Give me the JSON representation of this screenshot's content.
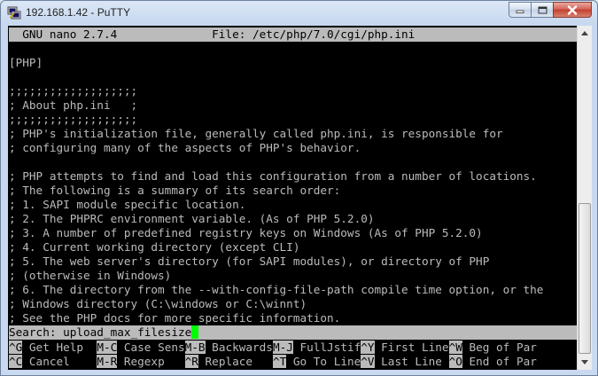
{
  "window": {
    "title": "192.168.1.42 - PuTTY"
  },
  "terminal": {
    "header": "  GNU nano 2.7.4              File: /etc/php/7.0/cgi/php.ini",
    "lines": [
      "",
      "[PHP]",
      "",
      ";;;;;;;;;;;;;;;;;;;",
      "; About php.ini   ;",
      ";;;;;;;;;;;;;;;;;;;",
      "; PHP's initialization file, generally called php.ini, is responsible for",
      "; configuring many of the aspects of PHP's behavior.",
      "",
      "; PHP attempts to find and load this configuration from a number of locations.",
      "; The following is a summary of its search order:",
      "; 1. SAPI module specific location.",
      "; 2. The PHPRC environment variable. (As of PHP 5.2.0)",
      "; 3. A number of predefined registry keys on Windows (As of PHP 5.2.0)",
      "; 4. Current working directory (except CLI)",
      "; 5. The web server's directory (for SAPI modules), or directory of PHP",
      "; (otherwise in Windows)",
      "; 6. The directory from the --with-config-file-path compile time option, or the",
      "; Windows directory (C:\\windows or C:\\winnt)",
      "; See the PHP docs for more specific information."
    ],
    "search_prompt": "Search: upload_max_filesize",
    "help_rows": [
      [
        {
          "key": "^G",
          "label": " Get Help  "
        },
        {
          "key": "M-C",
          "label": " Case Sens"
        },
        {
          "key": "M-B",
          "label": " Backwards"
        },
        {
          "key": "M-J",
          "label": " FullJstif"
        },
        {
          "key": "^Y",
          "label": " First Line"
        },
        {
          "key": "^W",
          "label": " Beg of Par"
        }
      ],
      [
        {
          "key": "^C",
          "label": " Cancel    "
        },
        {
          "key": "M-R",
          "label": " Regexp   "
        },
        {
          "key": "^R",
          "label": " Replace   "
        },
        {
          "key": "^T",
          "label": " Go To Line"
        },
        {
          "key": "^V",
          "label": " Last Line "
        },
        {
          "key": "^O",
          "label": " End of Par"
        }
      ]
    ]
  },
  "icons": {
    "app": "putty-icon",
    "minimize": "minimize-icon",
    "maximize": "maximize-icon",
    "close": "close-icon",
    "scroll_up": "scroll-up-arrow-icon",
    "scroll_down": "scroll-down-arrow-icon"
  },
  "colors": {
    "terminal_bg": "#000000",
    "terminal_fg": "#bbbbbb",
    "cursor": "#00ff00",
    "close_button": "#c4402f"
  }
}
